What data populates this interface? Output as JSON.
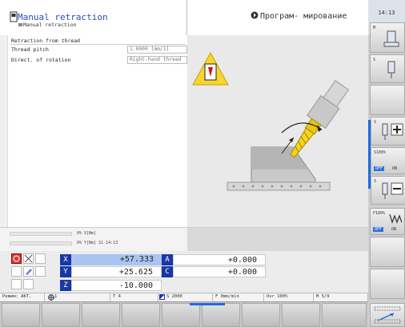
{
  "header": {
    "title": "Manual retraction",
    "subtitle": "Manual retraction",
    "mode": "Програм- мирование",
    "clock": "14:13"
  },
  "form": {
    "heading": "Retraction from thread",
    "fields": [
      {
        "label": "Thread pitch",
        "value": "1.0000 [mm/1]"
      },
      {
        "label": "Direct. of rotation",
        "value": "Right-hand thread"
      }
    ]
  },
  "strip": {
    "line1": "0% X[Nm]",
    "line2": "0% Y[Nm] S1  14:13"
  },
  "axes": [
    {
      "letter": "X",
      "value": "+57.333",
      "letter2": "A",
      "value2": "+0.000"
    },
    {
      "letter": "Y",
      "value": "+25.625",
      "letter2": "C",
      "value2": "+0.000"
    },
    {
      "letter": "Z",
      "value": "-10.000"
    }
  ],
  "status": {
    "mode": "Режим: АКТ.",
    "t1": "1",
    "tool": "T 4",
    "spindle": "S 2000",
    "feed": "F 0mm/min",
    "ovr": "Ovr 100%",
    "m": "M 5/9"
  },
  "right_keys": {
    "m": "M",
    "s": "S",
    "s100": "S100%",
    "off": "OFF",
    "on": "ON",
    "s2": "S",
    "f100": "F100%",
    "off2": "OFF",
    "on2": "ON"
  }
}
